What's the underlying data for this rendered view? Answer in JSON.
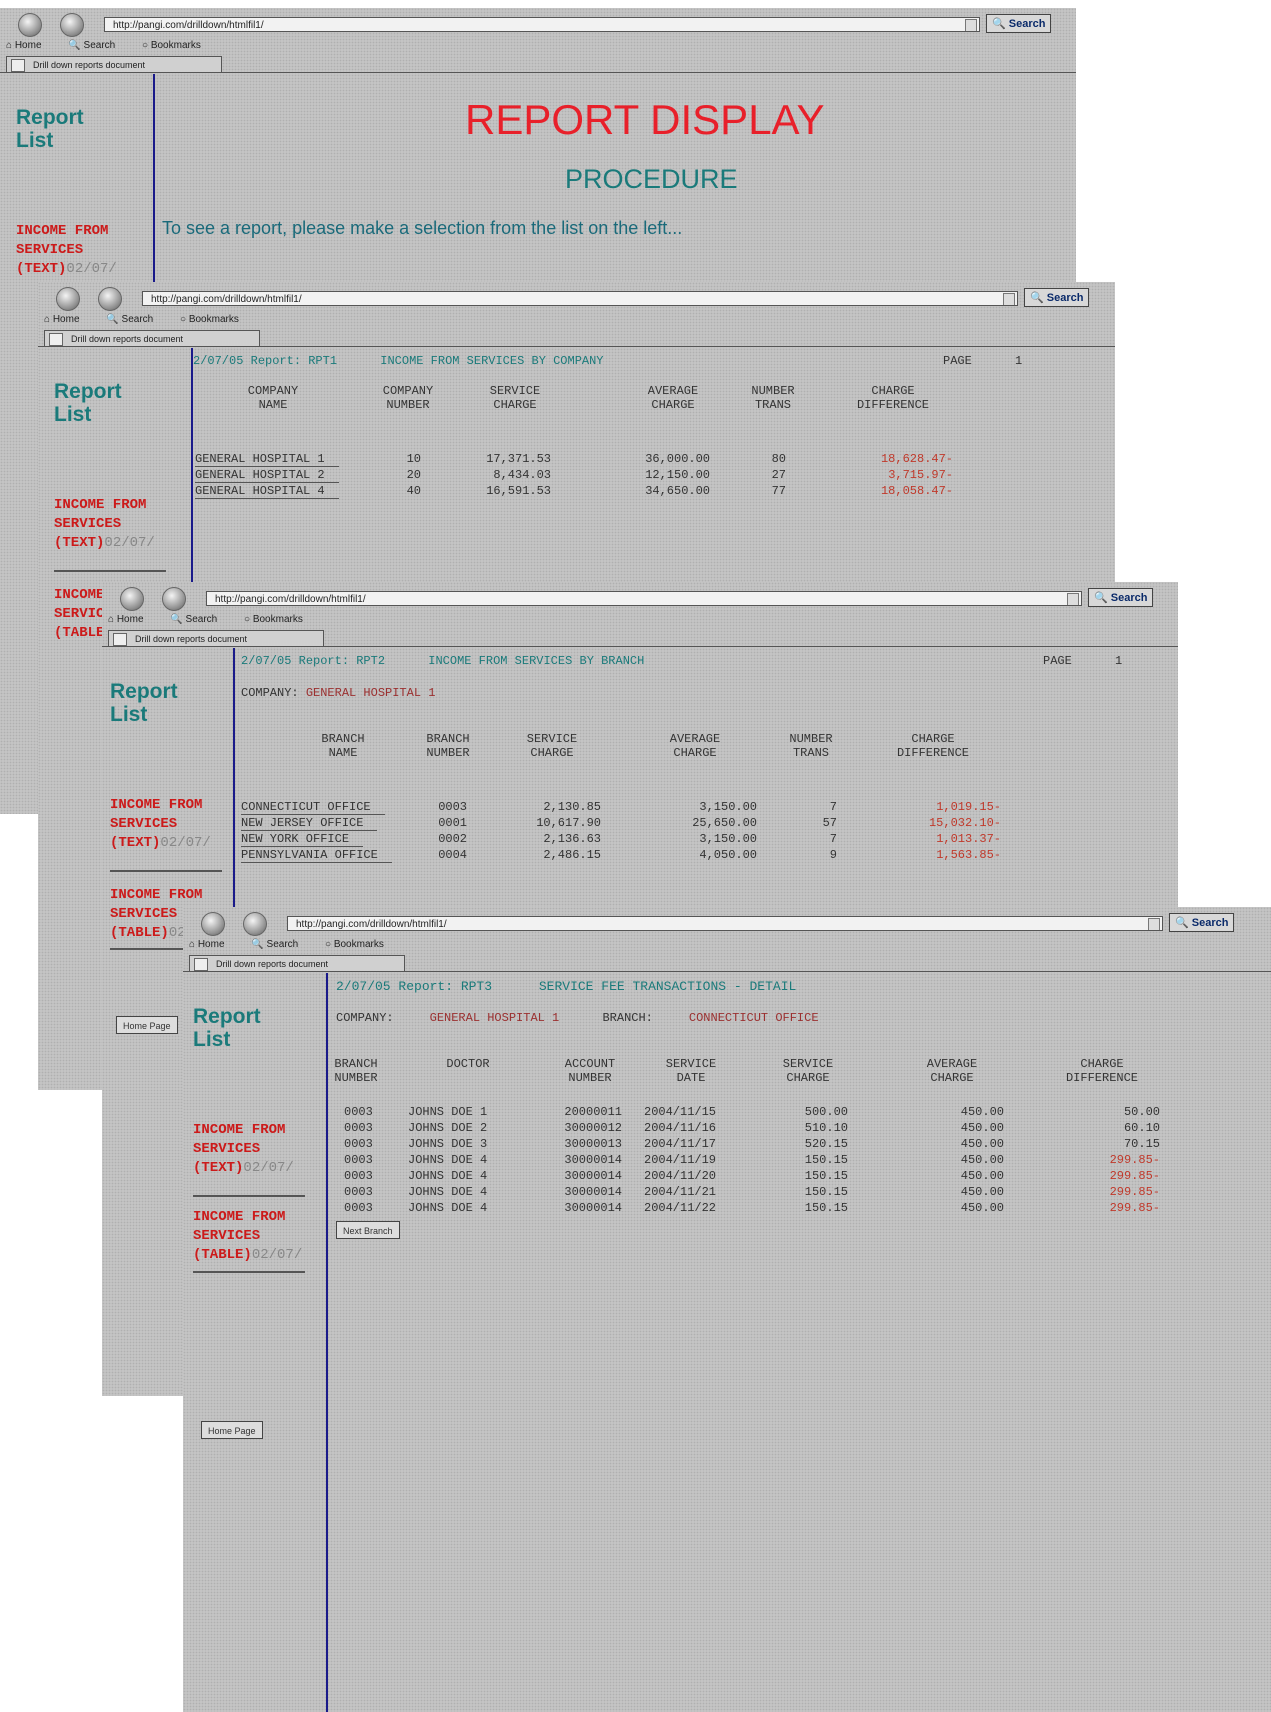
{
  "browser": {
    "url": "http://pangi.com/drilldown/htmlfil1/",
    "search_label": "Search",
    "nav_home": "Home",
    "nav_search": "Search",
    "nav_bookmarks": "Bookmarks",
    "tab_title": "Drill down reports document"
  },
  "sidebar": {
    "title": "Report List",
    "link1_text": "INCOME FROM SERVICES (TEXT)",
    "link1_date": "02/07/",
    "link2_text": "INCOME FROM SERVICES (TABLE)",
    "link2_date": "02/07/",
    "home_button": "Home Page"
  },
  "win1": {
    "title": "REPORT DISPLAY",
    "subtitle": "PROCEDURE",
    "instruction": "To see a report, please make a selection from the list on the left..."
  },
  "win2": {
    "header_date": "2/07/05",
    "header_report": "Report: RPT1",
    "header_title": "INCOME FROM SERVICES BY COMPANY",
    "page_label": "PAGE",
    "page_num": "1",
    "columns": [
      "COMPANY\nNAME",
      "COMPANY\nNUMBER",
      "SERVICE\nCHARGE",
      "AVERAGE\nCHARGE",
      "NUMBER\nTRANS",
      "CHARGE\nDIFFERENCE"
    ],
    "rows": [
      {
        "name": "GENERAL HOSPITAL 1",
        "number": "10",
        "service": "17,371.53",
        "average": "36,000.00",
        "trans": "80",
        "diff": "18,628.47-"
      },
      {
        "name": "GENERAL HOSPITAL 2",
        "number": "20",
        "service": "8,434.03",
        "average": "12,150.00",
        "trans": "27",
        "diff": "3,715.97-"
      },
      {
        "name": "GENERAL HOSPITAL 4",
        "number": "40",
        "service": "16,591.53",
        "average": "34,650.00",
        "trans": "77",
        "diff": "18,058.47-"
      }
    ]
  },
  "win3": {
    "header_date": "2/07/05",
    "header_report": "Report: RPT2",
    "header_title": "INCOME FROM SERVICES BY BRANCH",
    "page_label": "PAGE",
    "page_num": "1",
    "company_label": "COMPANY:",
    "company_value": "GENERAL HOSPITAL 1",
    "columns": [
      "BRANCH\nNAME",
      "BRANCH\nNUMBER",
      "SERVICE\nCHARGE",
      "AVERAGE\nCHARGE",
      "NUMBER\nTRANS",
      "CHARGE\nDIFFERENCE"
    ],
    "rows": [
      {
        "name": "CONNECTICUT OFFICE",
        "number": "0003",
        "service": "2,130.85",
        "average": "3,150.00",
        "trans": "7",
        "diff": "1,019.15-"
      },
      {
        "name": "NEW JERSEY OFFICE",
        "number": "0001",
        "service": "10,617.90",
        "average": "25,650.00",
        "trans": "57",
        "diff": "15,032.10-"
      },
      {
        "name": "NEW YORK OFFICE",
        "number": "0002",
        "service": "2,136.63",
        "average": "3,150.00",
        "trans": "7",
        "diff": "1,013.37-"
      },
      {
        "name": "PENNSYLVANIA OFFICE",
        "number": "0004",
        "service": "2,486.15",
        "average": "4,050.00",
        "trans": "9",
        "diff": "1,563.85-"
      }
    ]
  },
  "win4": {
    "header_date": "2/07/05",
    "header_report": "Report: RPT3",
    "header_title": "SERVICE FEE TRANSACTIONS - DETAIL",
    "company_label": "COMPANY:",
    "company_value": "GENERAL HOSPITAL 1",
    "branch_label": "BRANCH:",
    "branch_value": "CONNECTICUT OFFICE",
    "columns": [
      "BRANCH\nNUMBER",
      "DOCTOR",
      "ACCOUNT\nNUMBER",
      "SERVICE\nDATE",
      "SERVICE\nCHARGE",
      "AVERAGE\nCHARGE",
      "CHARGE\nDIFFERENCE"
    ],
    "rows": [
      {
        "branch": "0003",
        "doctor": "JOHNS DOE 1",
        "account": "20000011",
        "date": "2004/11/15",
        "service": "500.00",
        "average": "450.00",
        "diff": "50.00",
        "neg": false
      },
      {
        "branch": "0003",
        "doctor": "JOHNS DOE 2",
        "account": "30000012",
        "date": "2004/11/16",
        "service": "510.10",
        "average": "450.00",
        "diff": "60.10",
        "neg": false
      },
      {
        "branch": "0003",
        "doctor": "JOHNS DOE 3",
        "account": "30000013",
        "date": "2004/11/17",
        "service": "520.15",
        "average": "450.00",
        "diff": "70.15",
        "neg": false
      },
      {
        "branch": "0003",
        "doctor": "JOHNS DOE 4",
        "account": "30000014",
        "date": "2004/11/19",
        "service": "150.15",
        "average": "450.00",
        "diff": "299.85-",
        "neg": true
      },
      {
        "branch": "0003",
        "doctor": "JOHNS DOE 4",
        "account": "30000014",
        "date": "2004/11/20",
        "service": "150.15",
        "average": "450.00",
        "diff": "299.85-",
        "neg": true
      },
      {
        "branch": "0003",
        "doctor": "JOHNS DOE 4",
        "account": "30000014",
        "date": "2004/11/21",
        "service": "150.15",
        "average": "450.00",
        "diff": "299.85-",
        "neg": true
      },
      {
        "branch": "0003",
        "doctor": "JOHNS DOE 4",
        "account": "30000014",
        "date": "2004/11/22",
        "service": "150.15",
        "average": "450.00",
        "diff": "299.85-",
        "neg": true
      }
    ],
    "next_button": "Next Branch"
  }
}
